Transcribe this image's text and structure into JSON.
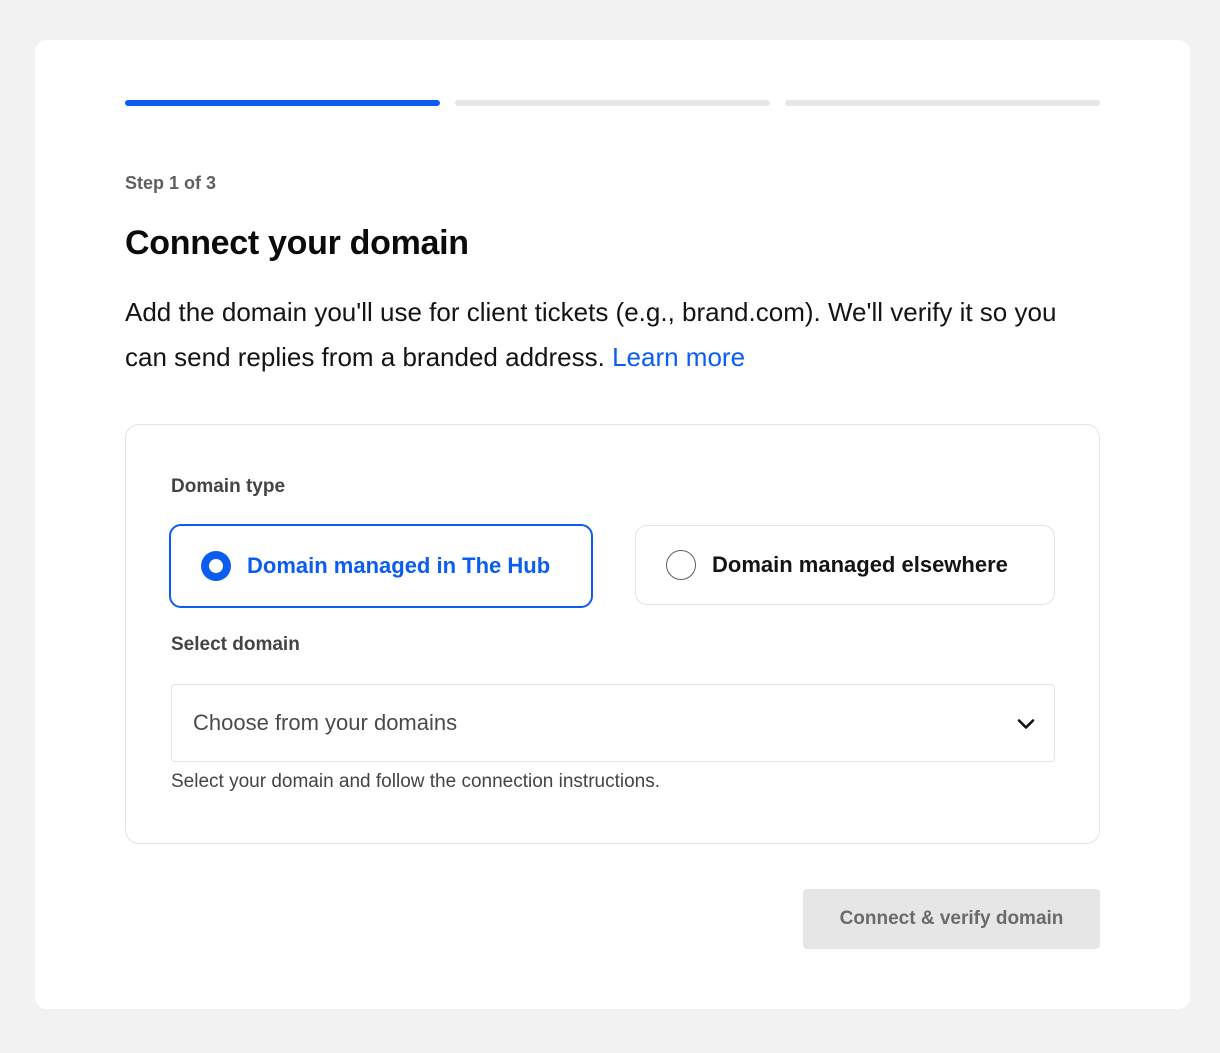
{
  "progress": {
    "current_step": 1,
    "total_steps": 3,
    "accent_color": "#0b5cf0",
    "inactive_color": "#e6e6e6"
  },
  "step_label": "Step 1 of 3",
  "title": "Connect your domain",
  "description": {
    "text": "Add the domain you'll use for client tickets (e.g., brand.com). We'll verify it so you can send replies from a branded address.",
    "link_text": "Learn more"
  },
  "domain_type": {
    "label": "Domain type",
    "options": [
      {
        "label": "Domain managed in The Hub",
        "selected": true
      },
      {
        "label": "Domain managed elsewhere",
        "selected": false
      }
    ]
  },
  "select_domain": {
    "label": "Select domain",
    "placeholder": "Choose from your domains",
    "icon": "chevron-down-icon",
    "hint": "Select your domain and follow the connection instructions."
  },
  "submit": {
    "label": "Connect & verify domain",
    "disabled": true
  }
}
